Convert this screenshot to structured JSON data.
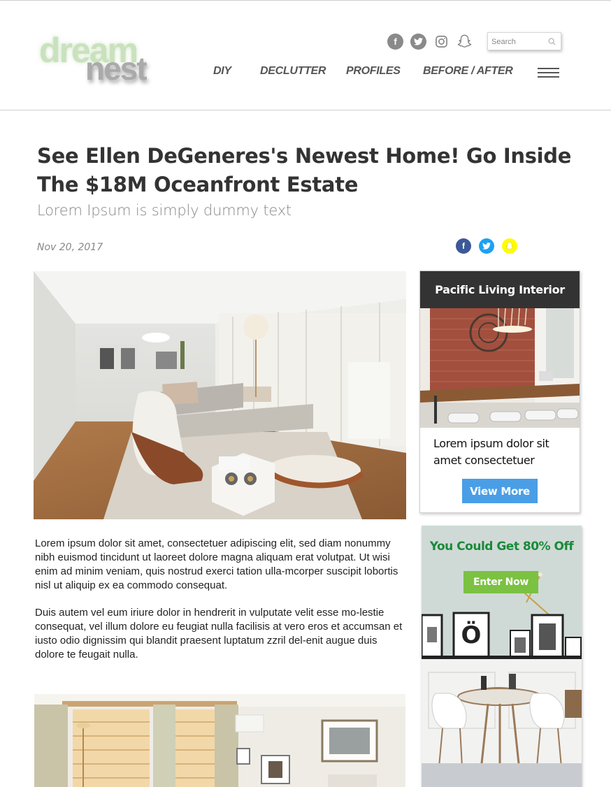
{
  "brand": {
    "logo_top": "dream",
    "logo_bottom": "nest"
  },
  "header": {
    "social": [
      "facebook-icon",
      "twitter-icon",
      "instagram-icon",
      "snapchat-icon"
    ],
    "search_placeholder": "Search",
    "nav": [
      "DIY",
      "DECLUTTER",
      "PROFILES",
      "BEFORE / AFTER"
    ]
  },
  "article": {
    "title": "See Ellen DeGeneres's Newest Home! Go Inside The $18M Oceanfront Estate",
    "subtitle": "Lorem Ipsum is simply dummy text",
    "date": "Nov 20, 2017",
    "share": [
      "facebook-icon",
      "twitter-icon",
      "snapchat-icon"
    ],
    "paragraphs": [
      "Lorem ipsum dolor sit amet, consectetuer adipiscing elit, sed diam nonummy nibh euismod tincidunt ut laoreet dolore magna aliquam erat volutpat. Ut wisi enim ad minim veniam, quis nostrud exerci tation ulla-mcorper suscipit lobortis nisl ut aliquip ex ea commodo consequat.",
      "Duis autem vel eum iriure dolor in hendrerit in vulputate velit esse mo-lestie consequat, vel illum dolore eu feugiat nulla facilisis at vero eros et accumsan et iusto odio dignissim qui blandit praesent luptatum zzril del-enit augue duis dolore te feugait nulla."
    ]
  },
  "sidebar": {
    "card": {
      "title": "Pacific Living Interior",
      "text": "Lorem ipsum dolor sit amet consectetuer",
      "button": "View More"
    },
    "ad": {
      "headline": "You Could Get 80% Off",
      "button": "Enter Now",
      "poster_letter": "Ö"
    }
  },
  "colors": {
    "card_header": "#333333",
    "view_more": "#4a9ee6",
    "ad_headline": "#1a8a3a",
    "enter_now": "#7bc142",
    "facebook": "#3b5998",
    "twitter": "#1da1f2",
    "snapchat": "#fffc00"
  }
}
